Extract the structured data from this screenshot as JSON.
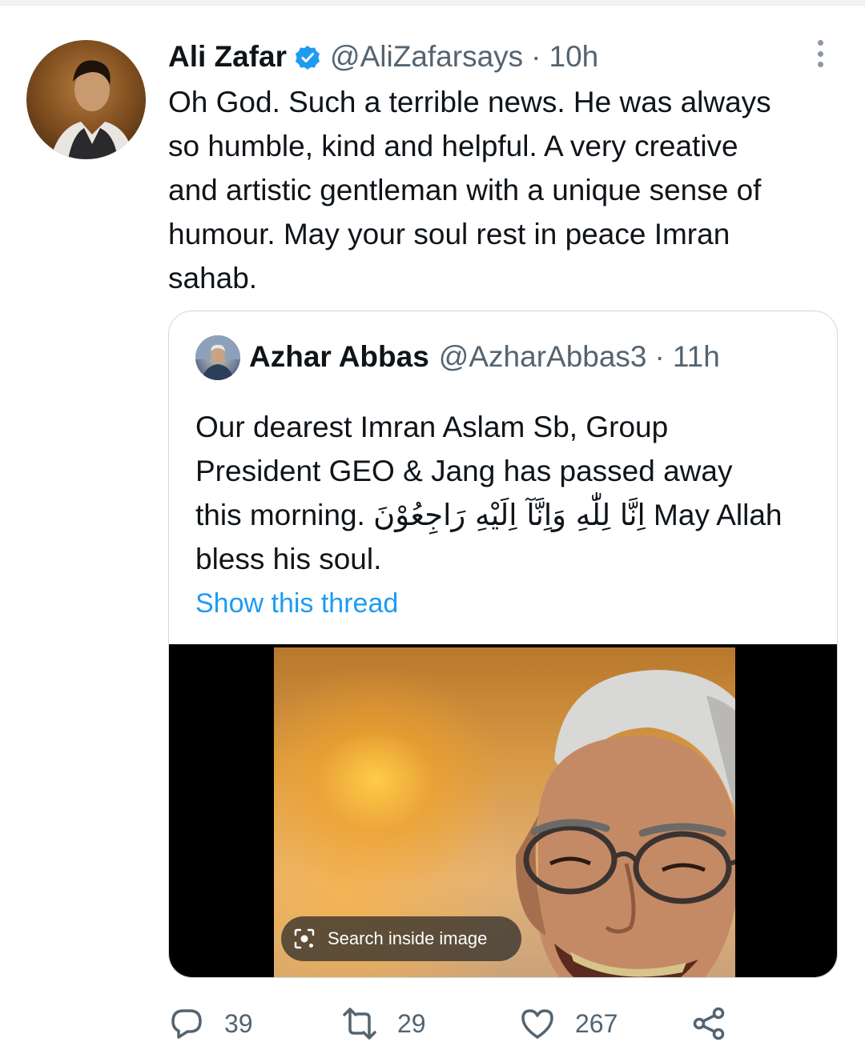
{
  "tweet": {
    "author_name": "Ali Zafar",
    "handle": "@AliZafarsays",
    "separator": "·",
    "time": "10h",
    "text": "Oh God. Such a terrible news. He was always\nso humble, kind and helpful. A very creative\nand artistic gentleman with a unique sense of\nhumour. May your soul rest in peace Imran\nsahab."
  },
  "quoted": {
    "author_name": "Azhar Abbas",
    "handle": "@AzharAbbas3",
    "separator": "·",
    "time": "11h",
    "text_line1": "Our dearest Imran Aslam Sb, Group",
    "text_line2": "President GEO & Jang has passed away",
    "text_line3_start": "this morning. ",
    "text_arabic": "اِنَّا لِلّٰهِ وَاِنَّآ اِلَيْهِ رَاجِعُوْنَ",
    "text_line3_end": " May Allah",
    "text_line4": "bless his soul.",
    "show_thread": "Show this thread",
    "search_inside_image": "Search inside image"
  },
  "actions": {
    "replies": "39",
    "retweets": "29",
    "likes": "267"
  },
  "colors": {
    "link": "#1d9bf0",
    "secondary_text": "#536471",
    "verified": "#1d9bf0"
  },
  "icons": [
    "verified-badge-icon",
    "more-options-icon",
    "reply-icon",
    "retweet-icon",
    "like-icon",
    "share-icon",
    "lens-icon"
  ]
}
